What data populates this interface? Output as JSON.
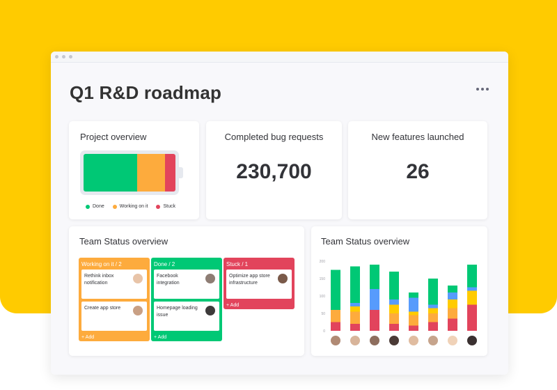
{
  "board": {
    "title": "Q1 R&D roadmap"
  },
  "project_overview": {
    "title": "Project overview",
    "segments": [
      {
        "label": "Done",
        "fraction": 0.58,
        "color": "#00c875"
      },
      {
        "label": "Working on it",
        "fraction": 0.31,
        "color": "#fdab3d"
      },
      {
        "label": "Stuck",
        "fraction": 0.11,
        "color": "#e2445c"
      }
    ]
  },
  "bug_requests": {
    "title": "Completed bug requests",
    "value": "230,700"
  },
  "features": {
    "title": "New features launched",
    "value": "26"
  },
  "kanban": {
    "title": "Team Status overview",
    "columns": [
      {
        "header": "Working on it / 2",
        "color": "#fdab3d",
        "add": "+ Add",
        "cards": [
          {
            "text": "Rethink inbox notification",
            "avatar": "#e8c4a8"
          },
          {
            "text": "Create app store",
            "avatar": "#c9a084"
          }
        ]
      },
      {
        "header": "Done / 2",
        "color": "#00c875",
        "add": "+ Add",
        "cards": [
          {
            "text": "Facebook integration",
            "avatar": "#8e7d74"
          },
          {
            "text": "Homepage loading issue",
            "avatar": "#3d3a3a"
          }
        ]
      },
      {
        "header": "Stuck / 1",
        "color": "#e2445c",
        "add": "+ Add",
        "cards": [
          {
            "text": "Optimize app store infrastructure",
            "avatar": "#7a5a4a"
          }
        ]
      }
    ]
  },
  "chart_title": "Team Status overview",
  "chart_data": {
    "type": "bar",
    "stacked": true,
    "yticks": [
      "200",
      "150",
      "100",
      "50",
      "0"
    ],
    "ylim": [
      0,
      200
    ],
    "categories": [
      "",
      "",
      "",
      "",
      "",
      "",
      "",
      ""
    ],
    "series": [
      {
        "color": "#e2445c",
        "values": [
          25,
          20,
          60,
          20,
          15,
          25,
          35,
          75
        ]
      },
      {
        "color": "#fdab3d",
        "values": [
          35,
          35,
          0,
          30,
          30,
          25,
          30,
          0
        ]
      },
      {
        "color": "#ffcb00",
        "values": [
          0,
          15,
          0,
          25,
          10,
          15,
          25,
          40
        ]
      },
      {
        "color": "#579bfc",
        "values": [
          0,
          10,
          60,
          15,
          40,
          10,
          20,
          10
        ]
      },
      {
        "color": "#00c875",
        "values": [
          115,
          105,
          70,
          80,
          15,
          75,
          20,
          65
        ]
      }
    ],
    "avatar_colors": [
      "#b08a74",
      "#d8b49a",
      "#8e6e5e",
      "#4a3a36",
      "#e0bca0",
      "#c6a48c",
      "#f0d2b8",
      "#3a3030"
    ]
  }
}
